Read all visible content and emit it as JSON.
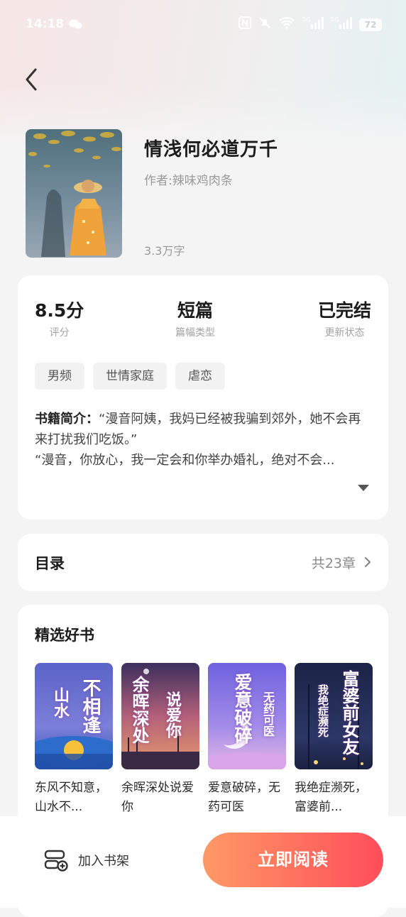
{
  "status_bar": {
    "time": "14:18",
    "battery": "72"
  },
  "book": {
    "title": "情浅何必道万千",
    "author": "作者:辣味鸡肉条",
    "word_count": "3.3万字"
  },
  "stats": [
    {
      "value": "8.5分",
      "label": "评分"
    },
    {
      "value": "短篇",
      "label": "篇幅类型"
    },
    {
      "value": "已完结",
      "label": "更新状态"
    }
  ],
  "tags": [
    "男频",
    "世情家庭",
    "虐恋"
  ],
  "intro": {
    "label": "书籍简介：",
    "line1": "“漫音阿姨，我妈已经被我骗到郊外，她不会再来打扰我们吃饭。”",
    "line2": "“漫音，你放心，我一定会和你举办婚礼，绝对不会..."
  },
  "toc": {
    "title": "目录",
    "count": "共23章"
  },
  "recommend": {
    "title": "精选好书",
    "books": [
      {
        "name": "东风不知意，山水不...",
        "cover_text": "不相逢",
        "cover_sub": "山水"
      },
      {
        "name": "余晖深处说爱你",
        "cover_text": "余晖深处",
        "cover_sub": "说爱你"
      },
      {
        "name": "爱意破碎，无药可医",
        "cover_text": "爱意破碎",
        "cover_sub": "无药可医"
      },
      {
        "name": "我绝症濒死，富婆前...",
        "cover_text": "富婆前女友",
        "cover_sub": "我绝症濒死"
      }
    ]
  },
  "bottom": {
    "shelf_label": "加入书架",
    "read_label": "立即阅读"
  },
  "colors": {
    "accent_start": "#ff9966",
    "accent_end": "#ff4d5c"
  }
}
